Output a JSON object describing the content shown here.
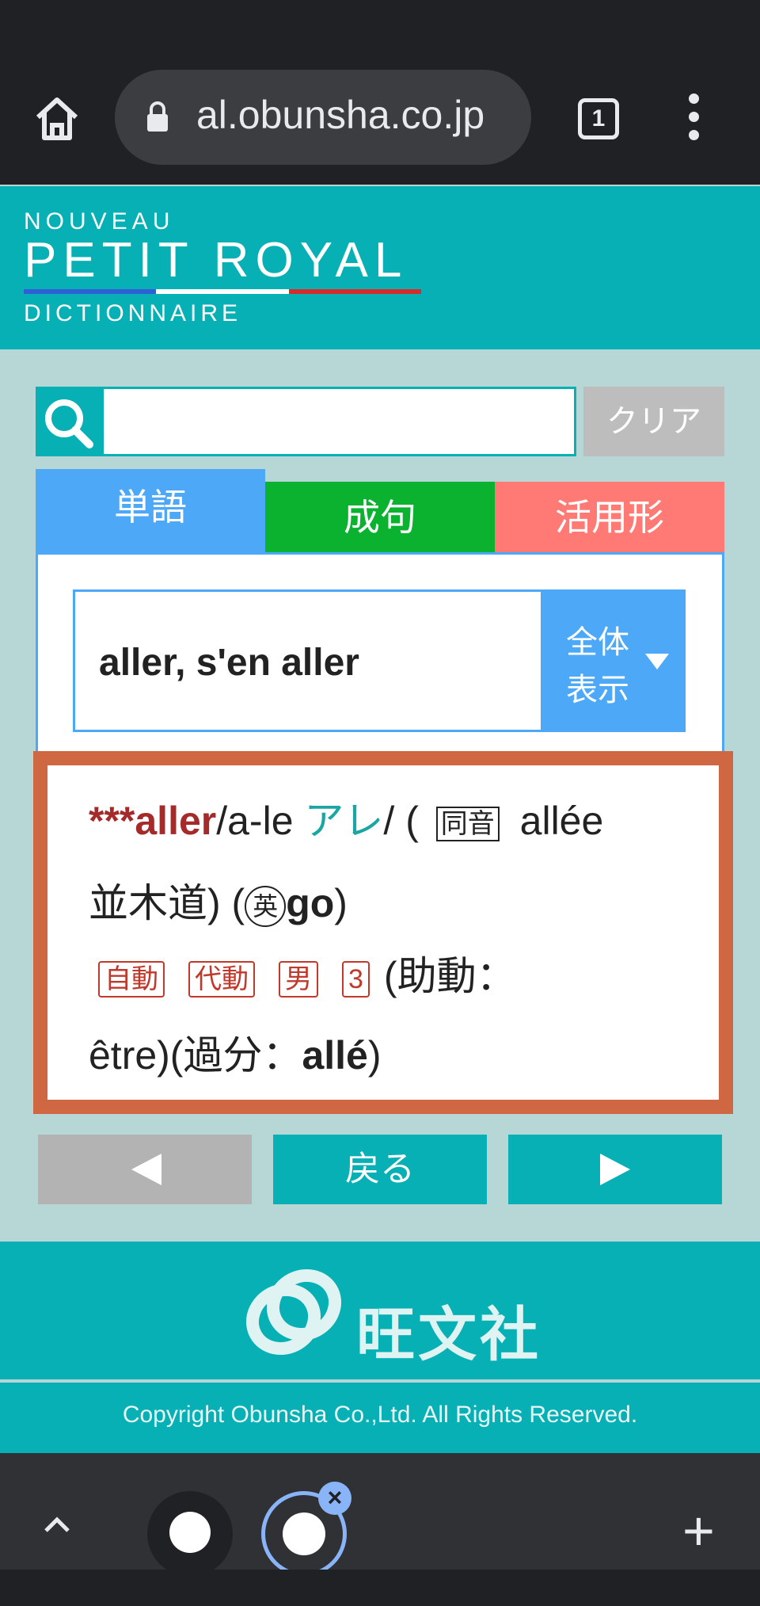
{
  "browser": {
    "url": "al.obunsha.co.jp",
    "tab_count": "1"
  },
  "logo": {
    "line1": "NOUVEAU",
    "line2": "PETIT ROYAL",
    "line3": "DICTIONNAIRE",
    "colors": [
      "#2f5fd6",
      "#ffffff",
      "#d62c2c"
    ]
  },
  "search": {
    "value": "",
    "clear_label": "クリア"
  },
  "tabs": [
    {
      "label": "単語",
      "color": "#4da8f8",
      "active": true
    },
    {
      "label": "成句",
      "color": "#0bb230",
      "active": false
    },
    {
      "label": "活用形",
      "color": "#ff7a74",
      "active": false
    }
  ],
  "result": {
    "selected": "aller, s'en aller",
    "view_label_1": "全体",
    "view_label_2": "表示"
  },
  "entry": {
    "stars": "***",
    "headword": "aller",
    "pron": "/a-le ",
    "kana": "アレ",
    "pron_end": "/ (",
    "homophone_tag": "同音",
    "homophone": "allée",
    "homophone_gloss": "並木道) (",
    "en_tag": "英",
    "en_word": "go",
    "close_paren": ")",
    "pos_tags": [
      "自動",
      "代動",
      "男",
      "3"
    ],
    "aux_text": "(助動：",
    "aux_value": "être)(過分：",
    "pp": "allé",
    "pp_close": ")"
  },
  "nav": {
    "back_label": "戻る"
  },
  "footer": {
    "brand": "旺文社",
    "copyright": "Copyright Obunsha Co.,Ltd. All Rights Reserved."
  },
  "colors": {
    "teal": "#06b0b4",
    "entry_border": "#d06743",
    "headword": "#a52a2a"
  }
}
